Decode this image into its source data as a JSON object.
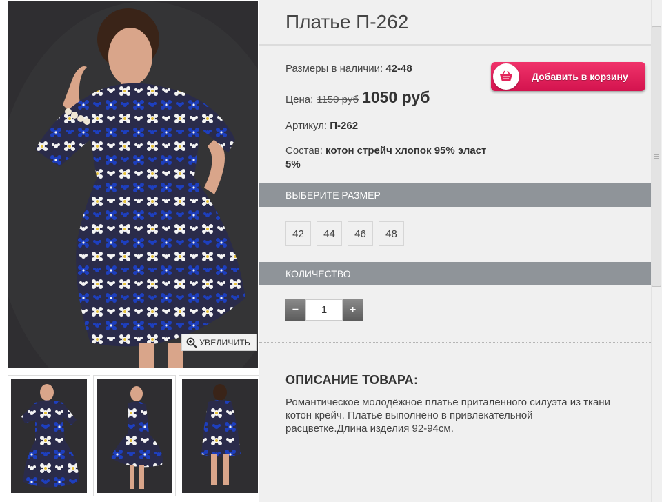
{
  "gallery": {
    "zoom_label": "УВЕЛИЧИТЬ",
    "colors": {
      "background": "#2f2e31",
      "dress_dark": "#2a2b4a",
      "flower_blue": "#1d3fbf",
      "flower_white": "#f4f4f4",
      "skin": "#d9a58a",
      "hair": "#3a2418"
    }
  },
  "product": {
    "title": "Платье П-262",
    "sizes_label": "Размеры в наличии:",
    "sizes_value": "42-48",
    "price_label": "Цена:",
    "old_price": "1150 руб",
    "new_price": "1050 руб",
    "sku_label": "Артикул:",
    "sku_value": "П-262",
    "composition_label": "Состав:",
    "composition_value": "котон стрейч хлопок 95% эласт 5%",
    "add_to_cart": "Добавить в корзину",
    "cart_icon": "basket-icon"
  },
  "size_section": {
    "header": "ВЫБЕРИТЕ РАЗМЕР",
    "options": [
      "42",
      "44",
      "46",
      "48"
    ]
  },
  "quantity_section": {
    "header": "КОЛИЧЕСТВО",
    "minus": "−",
    "plus": "+",
    "value": "1"
  },
  "description": {
    "title": "ОПИСАНИЕ ТОВАРА:",
    "text": "Романтическое молодёжное платье приталенного силуэта из ткани котон крейч.  Платье выполнено в привлекательной расцветке.Длина изделия 92-94см."
  },
  "theme": {
    "accent": "#e3245b",
    "bar": "#8f9499",
    "panel": "#f0f0f0"
  }
}
